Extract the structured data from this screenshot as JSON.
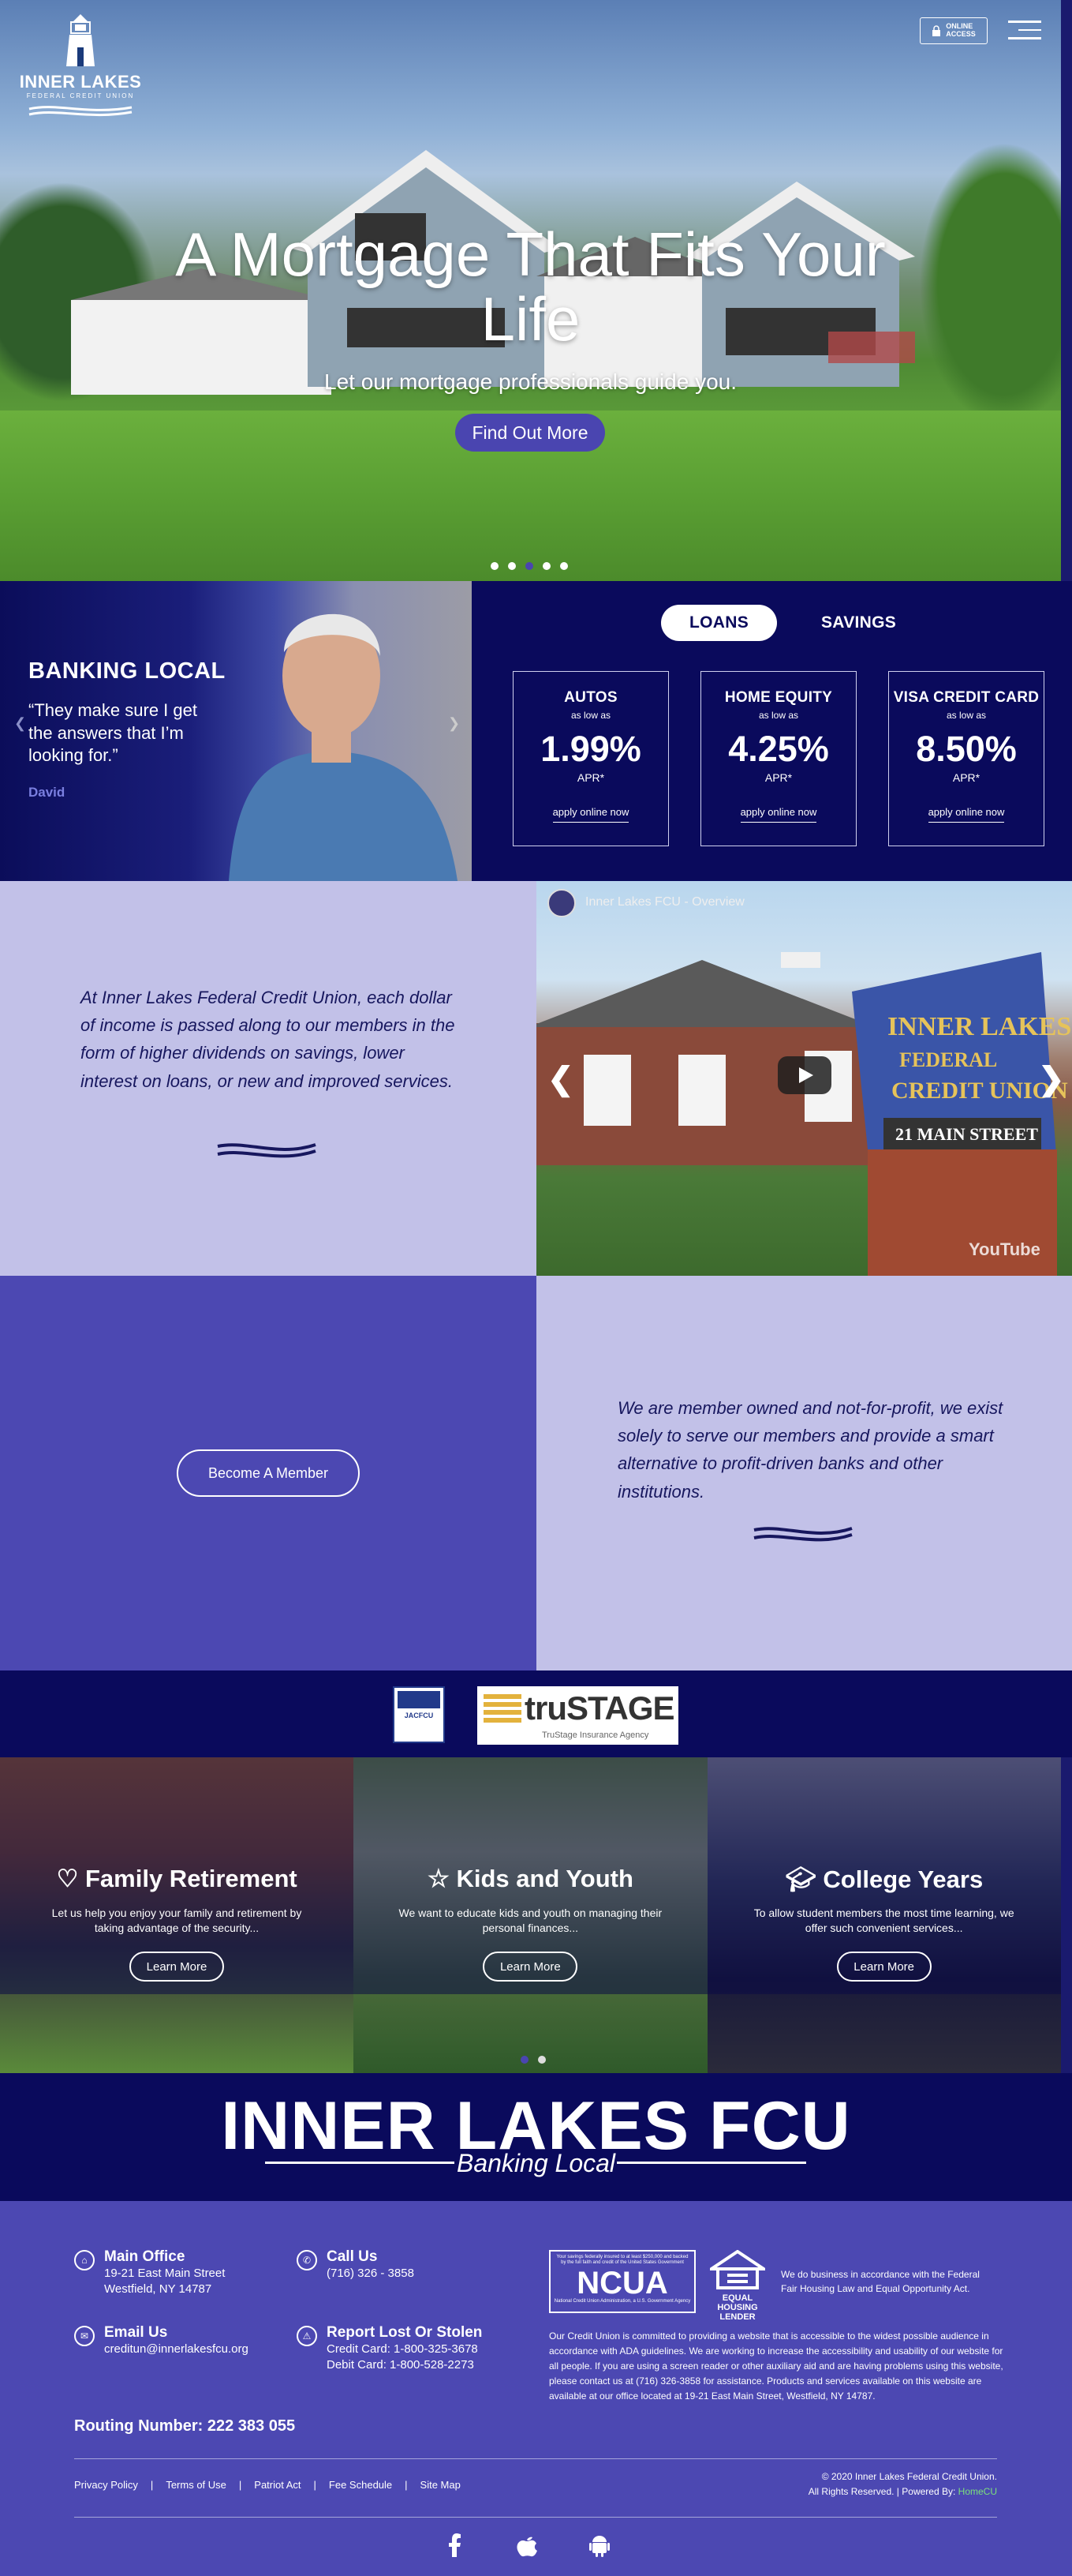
{
  "header": {
    "logo_name": "INNER LAKES",
    "logo_sub": "FEDERAL CREDIT UNION",
    "online_access": [
      "ONLINE",
      "ACCESS"
    ]
  },
  "hero": {
    "title": "A Mortgage That Fits Your Life",
    "subtitle": "Let our mortgage professionals guide you.",
    "button": "Find Out More",
    "slide_count": 5,
    "active_slide": 3
  },
  "banking": {
    "heading": "BANKING LOCAL",
    "quote": "“They make sure I get the answers that I’m looking for.”",
    "author": "David"
  },
  "rates": {
    "tabs": [
      {
        "label": "LOANS",
        "active": true
      },
      {
        "label": "SAVINGS",
        "active": false
      }
    ],
    "cards": [
      {
        "name": "AUTOS",
        "as_low_as": "as low as",
        "rate": "1.99%",
        "apr": "APR*",
        "link": "apply online now"
      },
      {
        "name": "HOME EQUITY",
        "as_low_as": "as low as",
        "rate": "4.25%",
        "apr": "APR*",
        "link": "apply online now"
      },
      {
        "name": "VISA CREDIT CARD",
        "as_low_as": "as low as",
        "rate": "8.50%",
        "apr": "APR*",
        "link": "apply online now"
      }
    ]
  },
  "mission": {
    "text": "At Inner Lakes Federal Credit Union, each dollar of income is passed along to our members in the form of higher dividends on savings, lower interest on loans, or new and improved services."
  },
  "video": {
    "title": "Inner Lakes FCU - Overview",
    "sign_line1": "INNER LAKES",
    "sign_line2": "FEDERAL",
    "sign_line3": "CREDIT UNION",
    "sign_address": "21 MAIN STREET",
    "platform": "YouTube"
  },
  "member": {
    "button": "Become A Member",
    "text": "We are member owned and not-for-profit, we exist solely to serve our members and provide a smart alternative to profit-driven banks and other institutions."
  },
  "partners": {
    "jacfcu": "JACFCU",
    "trustage": "truSTAGE",
    "trustage_tag": "TruStage Insurance Agency"
  },
  "stages": [
    {
      "title": "Family Retirement",
      "desc": "Let us help you enjoy your family and retirement by taking advantage of the security...",
      "button": "Learn More",
      "icon": "heart-icon"
    },
    {
      "title": "Kids and Youth",
      "desc": "We want to educate kids and youth on managing their personal finances...",
      "button": "Learn More",
      "icon": "star-icon"
    },
    {
      "title": "College Years",
      "desc": "To allow student members the most time learning, we offer such convenient services...",
      "button": "Learn More",
      "icon": "graduation-cap-icon"
    }
  ],
  "brand": {
    "name": "INNER LAKES FCU",
    "tagline": "Banking Local"
  },
  "footer": {
    "main_office": {
      "title": "Main Office",
      "line1": "19-21 East Main Street",
      "line2": "Westfield, NY 14787"
    },
    "call_us": {
      "title": "Call Us",
      "phone": "(716) 326 - 3858"
    },
    "email": {
      "title": "Email Us",
      "address": "creditun@innerlakesfcu.org"
    },
    "report": {
      "title": "Report Lost Or Stolen",
      "credit": "Credit Card: 1-800-325-3678",
      "debit": "Debit Card: 1-800-528-2273"
    },
    "routing": "Routing Number: 222 383 055",
    "ncua_top": "Your savings federally insured to at least $250,000 and backed by the full faith and credit of the United States Government",
    "ncua": "NCUA",
    "ncua_bottom": "National Credit Union Administration, a U.S. Government Agency",
    "ehl": [
      "EQUAL HOUSING",
      "LENDER"
    ],
    "fair_housing": "We do business in accordance with the Federal Fair Housing Law and Equal Opportunity Act.",
    "accessibility": "Our Credit Union is committed to providing a website that is accessible to the widest possible audience in accordance with ADA guidelines. We are working to increase the accessibility and usability of our website for all people. If you are using a screen reader or other auxiliary aid and are having problems using this website, please contact us at (716) 326-3858 for assistance. Products and services available on this website are available at our office located at 19-21 East Main Street, Westfield, NY 14787.",
    "links": [
      "Privacy Policy",
      "Terms of Use",
      "Patriot Act",
      "Fee Schedule",
      "Site Map"
    ],
    "copyright": "© 2020  Inner Lakes Federal Credit Union.",
    "rights": "All Rights Reserved.",
    "powered": "Powered By:",
    "powered_brand": "HomeCU",
    "social": [
      "facebook-icon",
      "apple-icon",
      "android-icon"
    ]
  },
  "colors": {
    "navy": "#0a0a5c",
    "purple": "#4c48b2",
    "lavender": "#c2c1e8",
    "accent": "#4a45b0"
  }
}
